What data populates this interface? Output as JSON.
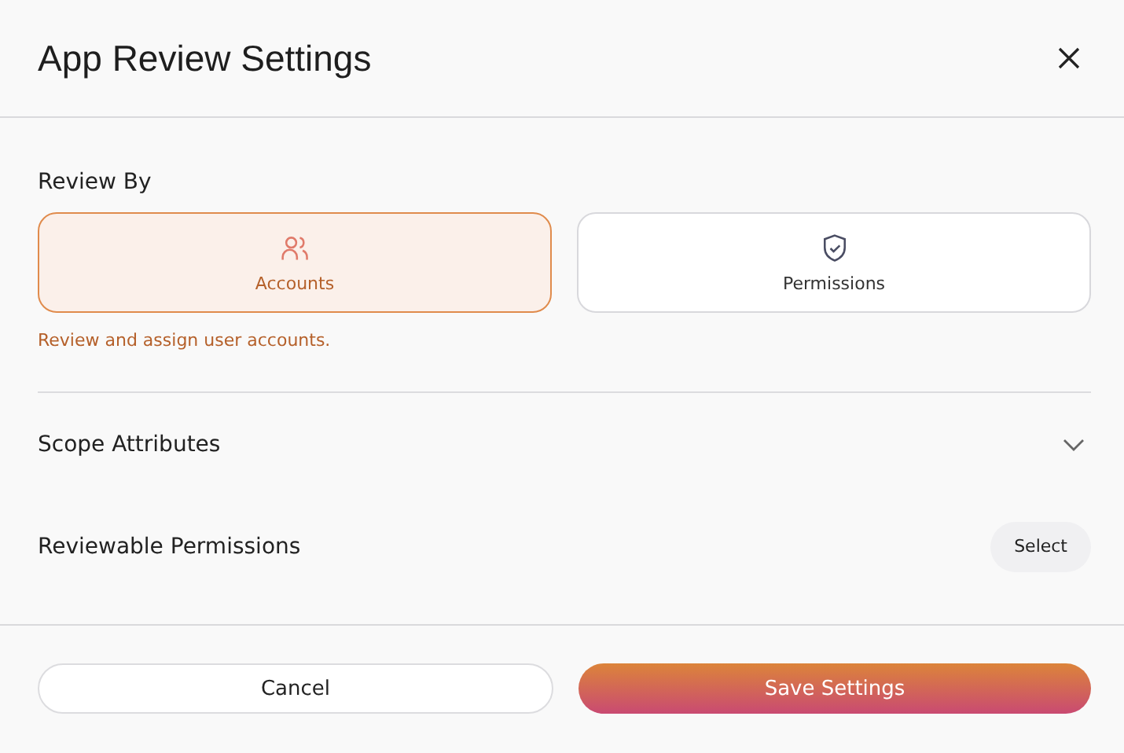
{
  "dialog": {
    "title": "App Review Settings"
  },
  "review_by": {
    "label": "Review By",
    "options": [
      {
        "label": "Accounts",
        "kind": "users",
        "selected": true
      },
      {
        "label": "Permissions",
        "kind": "shield",
        "selected": false
      }
    ],
    "description": "Review and assign user accounts."
  },
  "sections": [
    {
      "kind": "accordion",
      "label": "Scope Attributes",
      "expanded": false
    },
    {
      "kind": "select",
      "label": "Reviewable Permissions",
      "button": "Select"
    }
  ],
  "footer": {
    "cancel": "Cancel",
    "save": "Save Settings"
  }
}
